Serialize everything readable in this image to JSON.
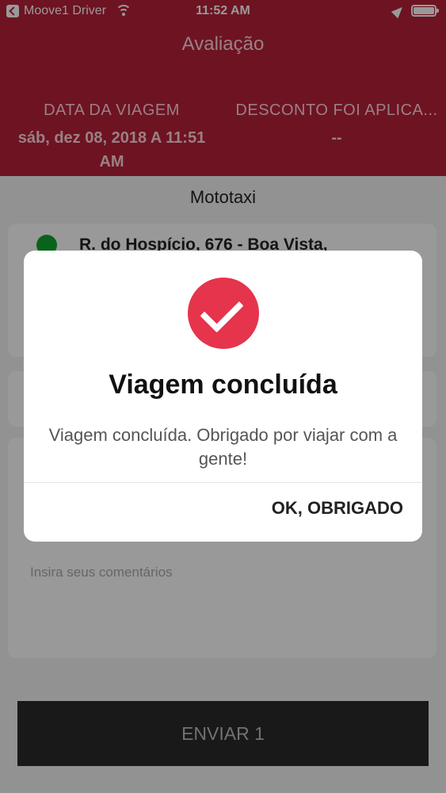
{
  "status_bar": {
    "carrier": "Moove1 Driver",
    "time": "11:52 AM"
  },
  "header": {
    "title": "Avaliação",
    "trip_date_label": "DATA DA VIAGEM",
    "trip_date_value": "sáb, dez 08, 2018 A 11:51 AM",
    "discount_label": "DESCONTO FOI APLICA...",
    "discount_value": "--"
  },
  "main": {
    "service_name": "Mototaxi",
    "origin_address": "R. do Hospício, 676 - Boa Vista,",
    "comments_placeholder": "Insira seus comentários",
    "send_label": "ENVIAR 1"
  },
  "dialog": {
    "title": "Viagem concluída",
    "message": "Viagem concluída. Obrigado por viajar com a gente!",
    "ok_label": "OK, OBRIGADO"
  },
  "colors": {
    "header": "#b8213a",
    "check_circle": "#e5344c",
    "origin_dot": "#12a62e"
  }
}
